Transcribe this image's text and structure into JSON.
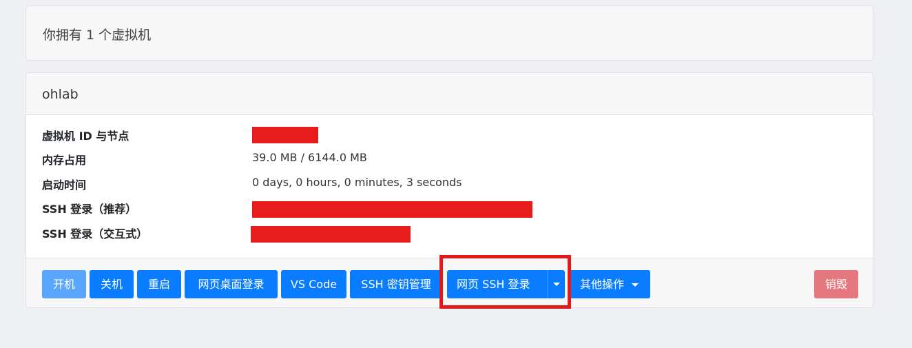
{
  "summary": {
    "text": "你拥有 1 个虚拟机"
  },
  "vm": {
    "name": "ohlab",
    "rows": [
      {
        "label": "虚拟机 ID 与节点",
        "value": ""
      },
      {
        "label": "内存占用",
        "value": "39.0 MB / 6144.0 MB"
      },
      {
        "label": "启动时间",
        "value": "0 days, 0 hours, 0 minutes, 3 seconds"
      },
      {
        "label": "SSH 登录（推荐）",
        "value": ""
      },
      {
        "label": "SSH 登录（交互式）",
        "value": ""
      }
    ],
    "buttons": {
      "start": "开机",
      "shutdown": "关机",
      "reboot": "重启",
      "web_desktop": "网页桌面登录",
      "vscode": "VS Code",
      "ssh_keys": "SSH 密钥管理",
      "web_ssh": "网页 SSH 登录",
      "other": "其他操作",
      "destroy": "销毁"
    }
  },
  "colors": {
    "primary": "#0a7cff",
    "primary_disabled": "#5aa6ff",
    "danger_disabled": "#e5787f",
    "redaction": "#e81c1c",
    "highlight_box": "#e01a1a"
  }
}
